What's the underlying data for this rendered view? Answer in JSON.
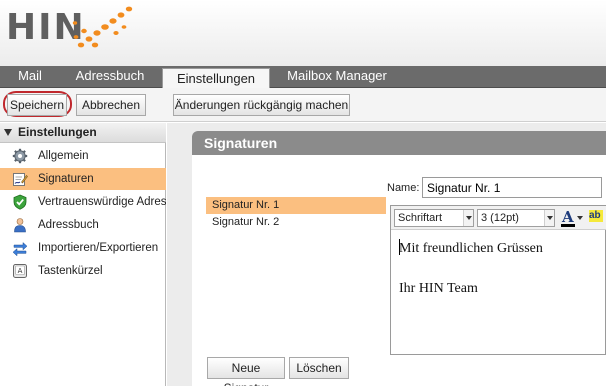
{
  "app": {
    "logo_text": "HIN",
    "brand_color": "#f28c1e",
    "selected_color": "#fbbf80",
    "alert_ring_color": "#c0282d"
  },
  "tabs": [
    {
      "label": "Mail",
      "active": false
    },
    {
      "label": "Adressbuch",
      "active": false
    },
    {
      "label": "Einstellungen",
      "active": true
    },
    {
      "label": "Mailbox Manager",
      "active": false
    }
  ],
  "toolbar": {
    "save_label": "Speichern",
    "cancel_label": "Abbrechen",
    "undo_label": "Änderungen rückgängig machen"
  },
  "sidebar": {
    "header": "Einstellungen",
    "items": [
      {
        "label": "Allgemein",
        "icon": "gear-icon",
        "selected": false
      },
      {
        "label": "Signaturen",
        "icon": "signature-icon",
        "selected": true
      },
      {
        "label": "Vertrauenswürdige Adressen",
        "icon": "shield-check-icon",
        "selected": false
      },
      {
        "label": "Adressbuch",
        "icon": "person-icon",
        "selected": false
      },
      {
        "label": "Importieren/Exportieren",
        "icon": "import-export-icon",
        "selected": false
      },
      {
        "label": "Tastenkürzel",
        "icon": "keyboard-key-icon",
        "selected": false
      }
    ]
  },
  "signatures": {
    "title": "Signaturen",
    "name_label": "Name:",
    "name_value": "Signatur Nr. 1",
    "list": [
      {
        "label": "Signatur Nr. 1",
        "selected": true
      },
      {
        "label": "Signatur Nr. 2",
        "selected": false
      }
    ],
    "editor": {
      "font_select": "Schriftart",
      "size_select": "3 (12pt)",
      "font_color_glyph": "A",
      "highlight_glyph": "ab",
      "lines": [
        "Mit freundlichen Grüssen",
        "",
        "Ihr HIN Team"
      ]
    },
    "new_label": "Neue Signatur",
    "delete_label": "Löschen"
  }
}
